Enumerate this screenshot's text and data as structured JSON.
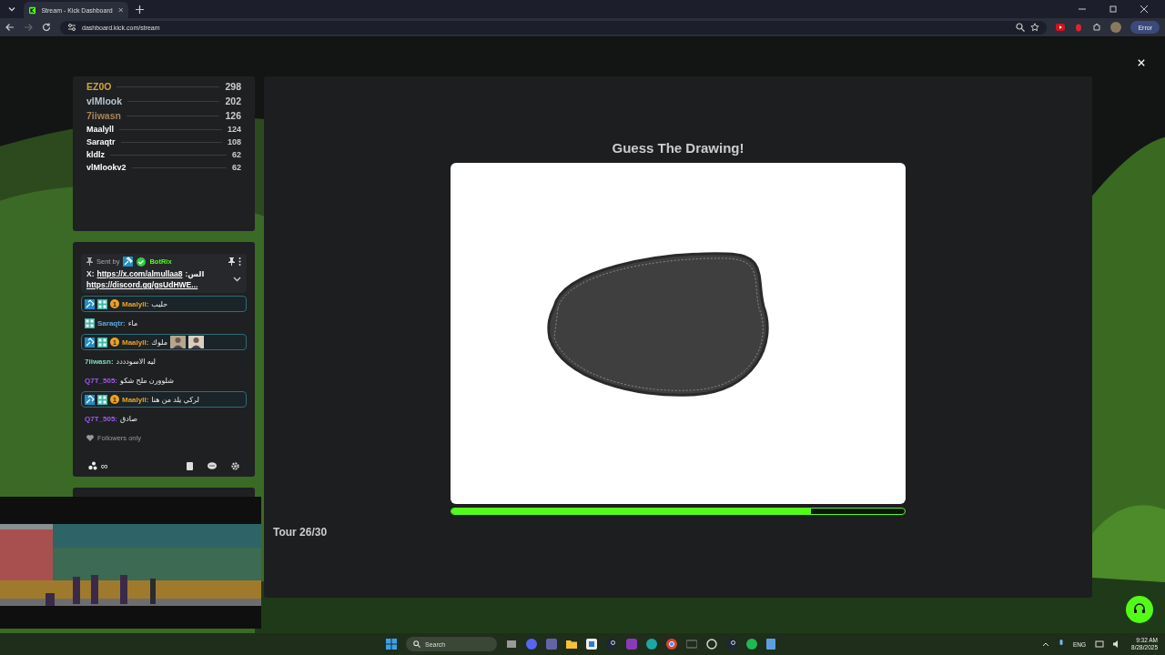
{
  "browser": {
    "tab_title": "Stream - Kick Dashboard",
    "url": "dashboard.kick.com/stream",
    "profile_label": "Error"
  },
  "leaderboard": [
    {
      "name": "EZ0O",
      "score": "298",
      "color": "#d4a53a"
    },
    {
      "name": "vlMlook",
      "score": "202",
      "color": "#b8c4d0"
    },
    {
      "name": "7iiwasn",
      "score": "126",
      "color": "#a8835a"
    },
    {
      "name": "Maalyll",
      "score": "124",
      "color": "#ffffff"
    },
    {
      "name": "Saraqtr",
      "score": "108",
      "color": "#ffffff"
    },
    {
      "name": "kldlz",
      "score": "62",
      "color": "#ffffff"
    },
    {
      "name": "vlMlookv2",
      "score": "62",
      "color": "#ffffff"
    }
  ],
  "pinned": {
    "sent_by": "Sent by",
    "author": "BotRix",
    "prefix": "X:",
    "link1": "https://x.com/almullaa8",
    "suffix": "الس:",
    "link2": "https://discord.gg/gsUdHWE..."
  },
  "chat": [
    {
      "user": "Maalyll:",
      "color": "#f0a020",
      "text": "حليب",
      "highlighted": true,
      "badges": [
        {
          "kind": "moderator"
        },
        {
          "kind": "subscriber"
        },
        {
          "kind": "tier",
          "text": "1"
        }
      ]
    },
    {
      "user": "Saraqtr:",
      "color": "#5aa8e0",
      "text": "ماء",
      "highlighted": false,
      "badges": [
        {
          "kind": "subscriber"
        }
      ]
    },
    {
      "user": "Maalyll:",
      "color": "#f0a020",
      "text": "ملوك",
      "highlighted": true,
      "badges": [
        {
          "kind": "moderator"
        },
        {
          "kind": "subscriber"
        },
        {
          "kind": "tier",
          "text": "1"
        }
      ]
    },
    {
      "user": "7iiwasn:",
      "color": "#7fd8c0",
      "text": "ليه الاسودددد",
      "highlighted": false
    },
    {
      "user": "Q7T_505:",
      "color": "#a15cf0",
      "text": "شلوورن ملح شكو",
      "highlighted": false
    },
    {
      "user": "Maalyll:",
      "color": "#f0a020",
      "text": "لركي يلد من هنا",
      "highlighted": true,
      "badges": [
        {
          "kind": "moderator"
        },
        {
          "kind": "subscriber"
        },
        {
          "kind": "tier",
          "text": "1"
        }
      ]
    },
    {
      "user": "Q7T_505:",
      "color": "#a15cf0",
      "text": "صادق",
      "highlighted": false
    }
  ],
  "chat_mode": "Followers only",
  "chat_footer": {
    "infinity": "∞"
  },
  "game": {
    "title": "Guess The Drawing!",
    "progress": {
      "level": 0.794
    },
    "round": "Tour 26/30"
  },
  "taskbar": {
    "search_placeholder": "Search",
    "language": "ENG",
    "time": "9:32 AM",
    "date": "8/28/2025"
  }
}
